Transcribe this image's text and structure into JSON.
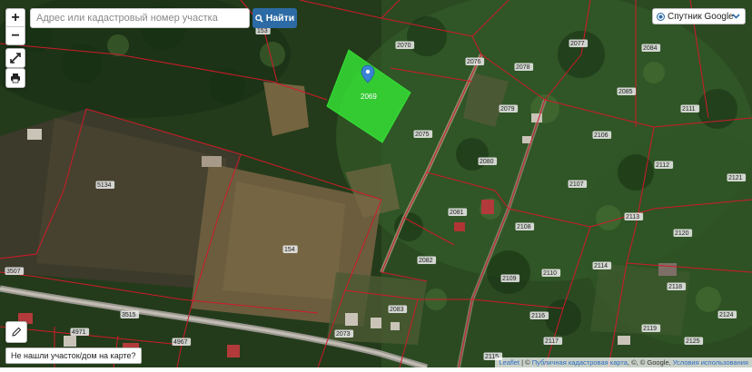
{
  "search": {
    "placeholder": "Адрес или кадастровый номер участка",
    "button_label": "Найти"
  },
  "zoom": {
    "in_label": "+",
    "out_label": "−"
  },
  "layer": {
    "selected": "Спутник Google"
  },
  "not_found_label": "Не нашли участок/дом на карте?",
  "attribution": {
    "leaflet": "Leaflet",
    "sep": " | © ",
    "pkk": "Публичная кадастровая карта",
    "google": ", ©, © Google, ",
    "terms": "Условия использования"
  },
  "selected_parcel": {
    "label": "2069",
    "color": "#35e035"
  },
  "parcel_labels": [
    "153",
    "2070",
    "2077",
    "2084",
    "2076",
    "2078",
    "2085",
    "2079",
    "2111",
    "2075",
    "2106",
    "2080",
    "2112",
    "2121",
    "5134",
    "2107",
    "2081",
    "2113",
    "2108",
    "2082",
    "2120",
    "154",
    "2114",
    "2109",
    "2118",
    "3507",
    "2110",
    "3515",
    "2083",
    "2116",
    "2119",
    "2124",
    "4971",
    "2073",
    "2125",
    "4967",
    "2117",
    "2115"
  ],
  "colors": {
    "boundary": "#d01a2a",
    "accent": "#2c6ba5"
  },
  "icons": [
    "zoom-in-icon",
    "zoom-out-icon",
    "fullscreen-icon",
    "print-icon",
    "search-icon",
    "chevron-down-icon",
    "pencil-icon",
    "map-pin-icon"
  ]
}
